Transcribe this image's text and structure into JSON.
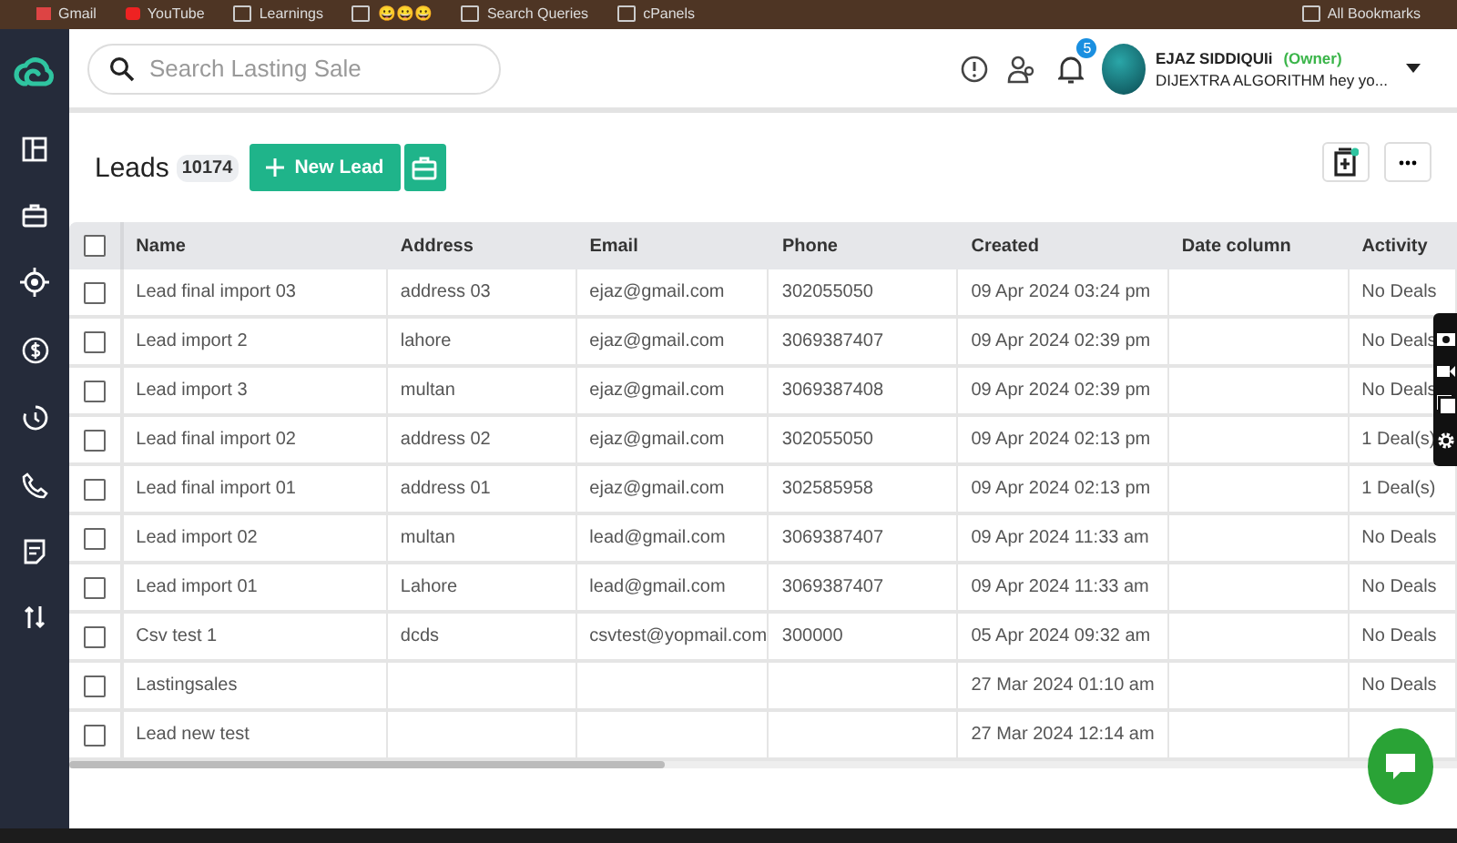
{
  "bookmarks": {
    "items": [
      {
        "label": "Gmail",
        "kind": "gmail"
      },
      {
        "label": "YouTube",
        "kind": "youtube"
      },
      {
        "label": "Learnings",
        "kind": "folder"
      },
      {
        "label": "😀😀😀",
        "kind": "folder"
      },
      {
        "label": "Search Queries",
        "kind": "folder"
      },
      {
        "label": "cPanels",
        "kind": "folder"
      }
    ],
    "all": "All Bookmarks"
  },
  "header": {
    "search": {
      "placeholder": "Search Lasting Sale"
    },
    "notifications": "5",
    "user": {
      "name": "EJAZ SIDDIQUIi",
      "role": "(Owner)",
      "company": "DIJEXTRA ALGORITHM hey yo..."
    }
  },
  "page": {
    "title": "Leads",
    "count": "10174",
    "new_button": "New Lead"
  },
  "table": {
    "select_all": {
      "checked": false
    },
    "columns": [
      "Name",
      "Address",
      "Email",
      "Phone",
      "Created",
      "Date column",
      "Activity"
    ],
    "rows": [
      {
        "checked": false,
        "cells": [
          "Lead final import 03",
          "address 03",
          "ejaz@gmail.com",
          "302055050",
          "09 Apr 2024 03:24 pm",
          "",
          "No Deals"
        ]
      },
      {
        "checked": false,
        "cells": [
          "Lead import 2",
          "lahore",
          "ejaz@gmail.com",
          "3069387407",
          "09 Apr 2024 02:39 pm",
          "",
          "No Deals"
        ]
      },
      {
        "checked": false,
        "cells": [
          "Lead import 3",
          "multan",
          "ejaz@gmail.com",
          "3069387408",
          "09 Apr 2024 02:39 pm",
          "",
          "No Deals"
        ]
      },
      {
        "checked": false,
        "cells": [
          "Lead final import 02",
          "address 02",
          "ejaz@gmail.com",
          "302055050",
          "09 Apr 2024 02:13 pm",
          "",
          "1 Deal(s)"
        ]
      },
      {
        "checked": false,
        "cells": [
          "Lead final import 01",
          "address 01",
          "ejaz@gmail.com",
          "302585958",
          "09 Apr 2024 02:13 pm",
          "",
          "1 Deal(s)"
        ]
      },
      {
        "checked": false,
        "cells": [
          "Lead import 02",
          "multan",
          "lead@gmail.com",
          "3069387407",
          "09 Apr 2024 11:33 am",
          "",
          "No Deals"
        ]
      },
      {
        "checked": false,
        "cells": [
          "Lead import 01",
          "Lahore",
          "lead@gmail.com",
          "3069387407",
          "09 Apr 2024 11:33 am",
          "",
          "No Deals"
        ]
      },
      {
        "checked": false,
        "cells": [
          "Csv test 1",
          "dcds",
          "csvtest@yopmail.com",
          "300000",
          "05 Apr 2024 09:32 am",
          "",
          "No Deals"
        ]
      },
      {
        "checked": false,
        "cells": [
          "Lastingsales",
          "",
          "",
          "",
          "27 Mar 2024 01:10 am",
          "",
          "No Deals"
        ]
      },
      {
        "checked": false,
        "cells": [
          "Lead new test",
          "",
          "",
          "",
          "27 Mar 2024 12:14 am",
          "",
          ""
        ]
      }
    ]
  }
}
